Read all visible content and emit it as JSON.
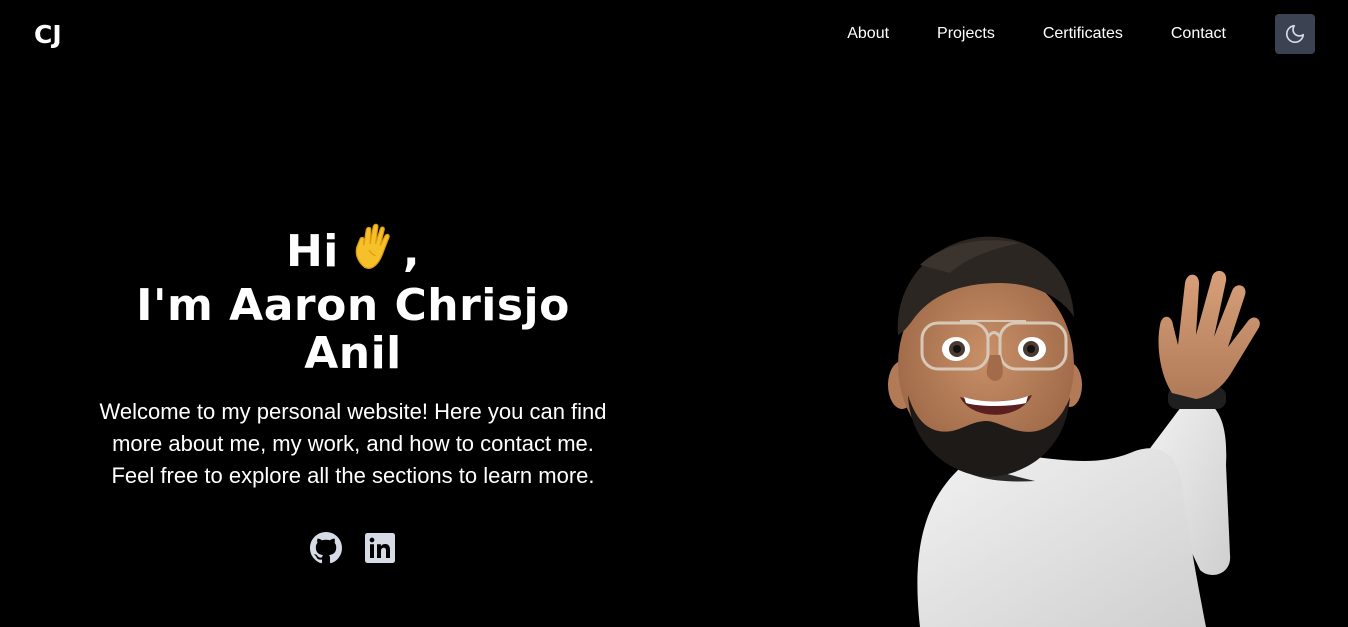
{
  "header": {
    "logo": "CJ",
    "nav": [
      {
        "label": "About"
      },
      {
        "label": "Projects"
      },
      {
        "label": "Certificates"
      },
      {
        "label": "Contact"
      }
    ],
    "theme_toggle_icon": "moon-icon"
  },
  "hero": {
    "greeting": "Hi",
    "greeting_suffix": ",",
    "greeting_icon": "waving-hand-icon",
    "name_line": "I'm Aaron Chrisjo Anil",
    "description": "Welcome to my personal website! Here you can find more about me, my work, and how to contact me. Feel free to explore all the sections to learn more.",
    "socials": [
      {
        "icon": "github-icon"
      },
      {
        "icon": "linkedin-icon"
      }
    ],
    "avatar_icon": "memoji-avatar"
  },
  "colors": {
    "background": "#000000",
    "text": "#ffffff",
    "toggle_bg": "#3b4252",
    "icon": "#d6dbe6"
  }
}
